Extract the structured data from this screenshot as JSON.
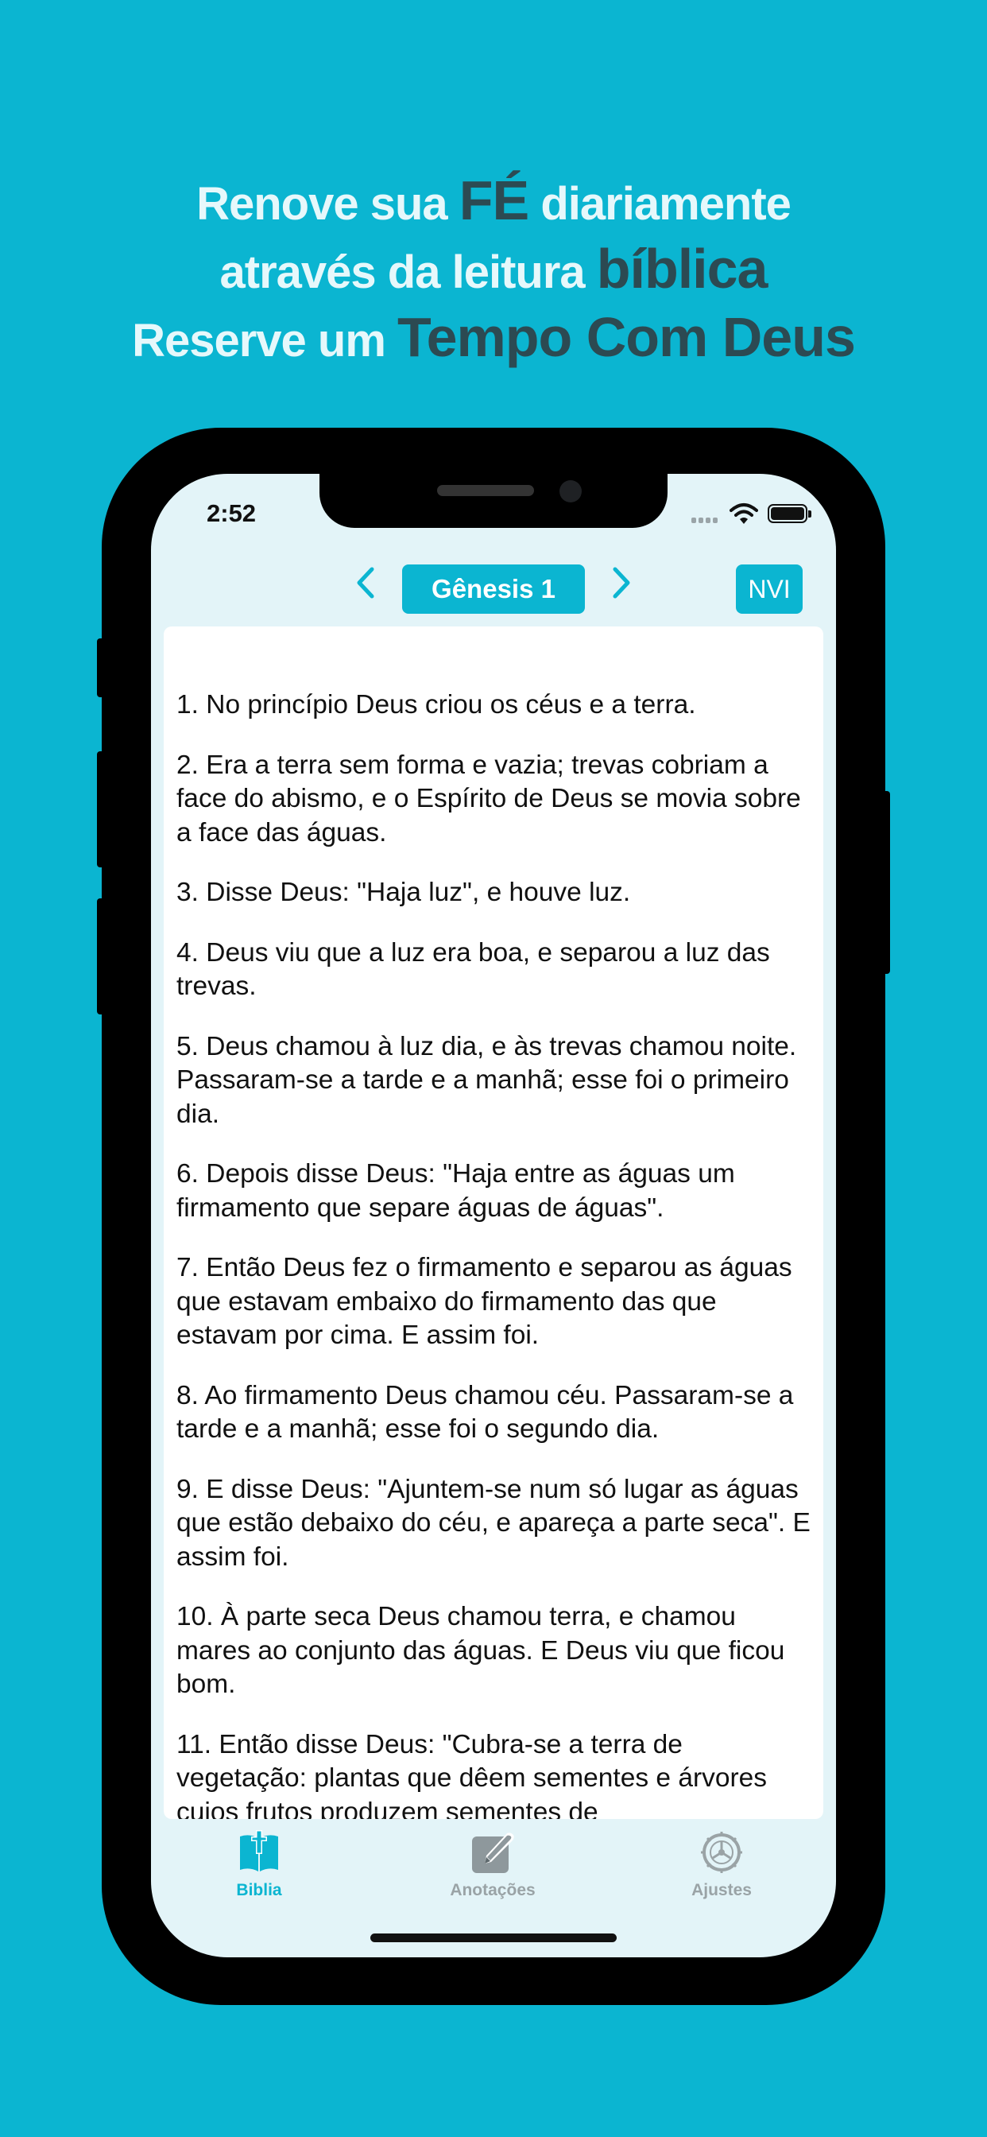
{
  "headline": {
    "line1": {
      "part1": "Renove sua ",
      "emph": "FÉ",
      "part2": " diariamente"
    },
    "line2": {
      "part1": "através da leitura ",
      "emph": "bíblica"
    },
    "line3": {
      "part1": "Reserve um ",
      "emph": "Tempo Com Deus"
    }
  },
  "status_bar": {
    "time": "2:52"
  },
  "toolbar": {
    "chapter": "Gênesis 1",
    "version": "NVI"
  },
  "verses": [
    "1.  No princípio Deus criou os céus e a terra.",
    "2.  Era a terra sem forma e vazia; trevas cobriam a face do abismo, e o Espírito de Deus se movia sobre a face das águas.",
    "3.  Disse Deus: \"Haja luz\", e houve luz.",
    "4.  Deus viu que a luz era boa, e separou a luz das trevas.",
    "5.  Deus chamou à luz dia, e às trevas chamou noite. Passaram-se a tarde e a manhã; esse foi o primeiro dia.",
    "6.  Depois disse Deus: \"Haja entre as águas um firmamento que separe águas de águas\".",
    "7.  Então Deus fez o firmamento e separou as águas que estavam embaixo do firmamento das que estavam por cima. E assim foi.",
    "8.  Ao firmamento Deus chamou céu. Passaram-se a tarde e a manhã; esse foi o segundo dia.",
    "9.  E disse Deus: \"Ajuntem-se num só lugar as águas que estão debaixo do céu, e apareça a parte seca\". E assim foi.",
    "10.  À parte seca Deus chamou terra, e chamou mares ao conjunto das águas. E Deus viu que ficou bom.",
    "11.  Então disse Deus: \"Cubra-se a terra de vegetação: plantas que dêem sementes e árvores cujos frutos produzem sementes de"
  ],
  "tabs": {
    "biblia": {
      "label": "Biblia",
      "icon": "bible-icon",
      "active": true
    },
    "anotacoes": {
      "label": "Anotações",
      "icon": "notes-edit-icon"
    },
    "ajustes": {
      "label": "Ajustes",
      "icon": "gear-icon"
    }
  },
  "colors": {
    "accent": "#0bb5d1",
    "headline_light": "#e6f8fb",
    "headline_dark": "#2c4a52",
    "screen_bg": "#e3f4f8",
    "inactive_tab": "#9aa3a6"
  }
}
